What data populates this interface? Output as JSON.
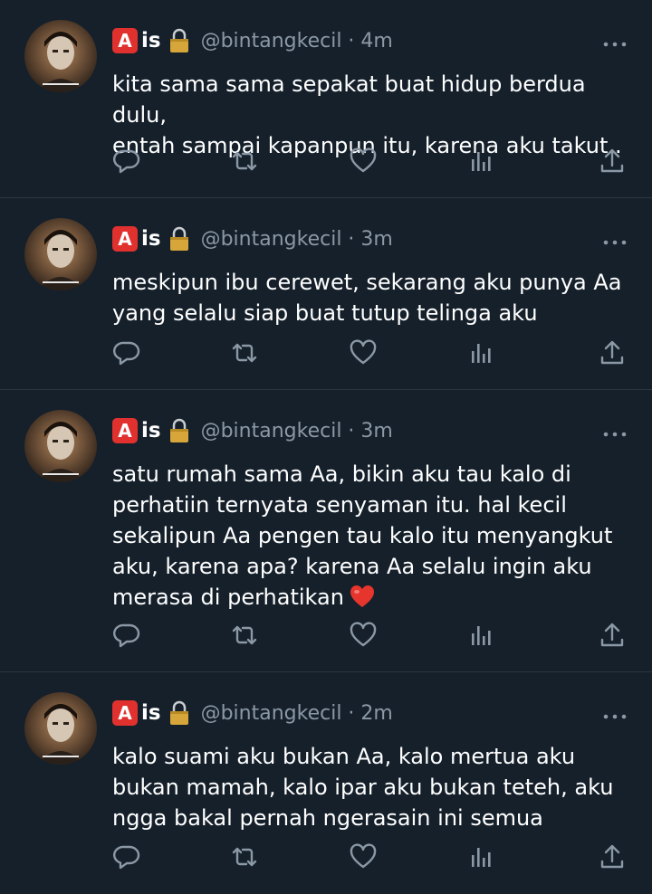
{
  "tweets": [
    {
      "badge": "A",
      "name": "is",
      "handle": "@bintangkecil · 4m",
      "lines": [
        "kita sama sama sepakat buat hidup berdua dulu,",
        "entah sampai kapanpun itu, karena aku takut.."
      ],
      "has_heart": false
    },
    {
      "badge": "A",
      "name": "is",
      "handle": "@bintangkecil · 3m",
      "lines": [
        "meskipun ibu cerewet, sekarang aku punya Aa",
        "yang selalu siap buat tutup telinga aku"
      ],
      "has_heart": false
    },
    {
      "badge": "A",
      "name": "is",
      "handle": "@bintangkecil · 3m",
      "lines": [
        "satu rumah sama Aa, bikin aku tau kalo di",
        "perhatiin ternyata senyaman itu. hal kecil",
        "sekalipun Aa pengen tau kalo itu menyangkut",
        "aku, karena apa? karena Aa selalu ingin aku",
        "merasa di perhatikan"
      ],
      "has_heart": true
    },
    {
      "badge": "A",
      "name": "is",
      "handle": "@bintangkecil · 2m",
      "lines": [
        "kalo suami aku bukan Aa, kalo mertua aku",
        "bukan mamah, kalo ipar aku bukan teteh, aku",
        "ngga bakal pernah ngerasain ini semua"
      ],
      "has_heart": false
    }
  ],
  "icons": {
    "reply": "reply-icon",
    "retweet": "retweet-icon",
    "like": "like-icon",
    "views": "views-icon",
    "share": "share-icon",
    "more": "more-icon",
    "lock": "lock-icon",
    "heart_emoji": "red-heart-emoji-icon"
  },
  "colors": {
    "background": "#15202b",
    "text": "#ffffff",
    "secondary": "#8b98a5",
    "badge": "#e0312e",
    "divider": "#2b3640"
  }
}
